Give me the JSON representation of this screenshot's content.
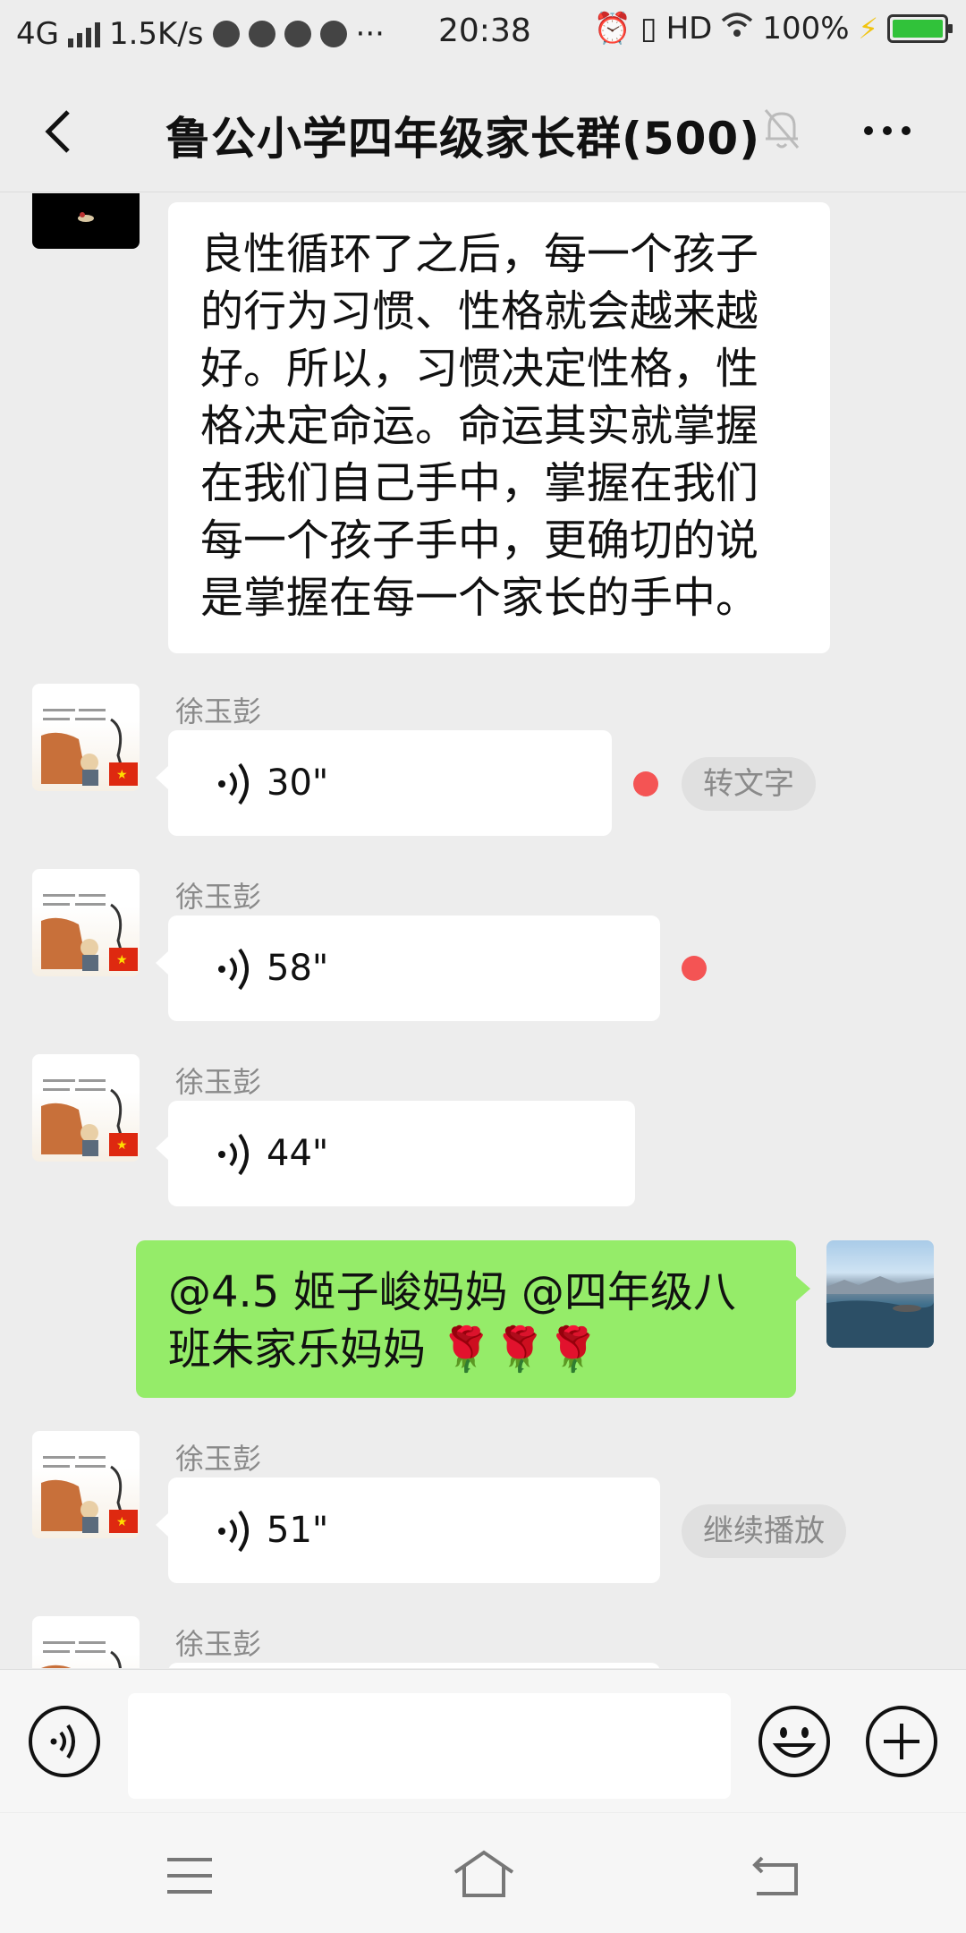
{
  "status_bar": {
    "network": "4G",
    "speed": "1.5K/s",
    "time": "20:38",
    "hd": "HD",
    "battery": "100%"
  },
  "header": {
    "title": "鲁公小学四年级家长群(500)"
  },
  "messages": [
    {
      "type": "text",
      "lines": [
        "良性循环了之后，每一个孩子",
        "的行为习惯、性格就会越来越",
        "好。所以，习惯决定性格，性",
        "格决定命运。命运其实就掌握",
        "在我们自己手中，掌握在我们",
        "每一个孩子手中，更确切的说",
        "是掌握在每一个家长的手中。"
      ]
    },
    {
      "type": "voice",
      "sender": "徐玉彭",
      "duration": "30\"",
      "action": "转文字"
    },
    {
      "type": "voice",
      "sender": "徐玉彭",
      "duration": "58\""
    },
    {
      "type": "voice",
      "sender": "徐玉彭",
      "duration": "44\""
    },
    {
      "type": "text_self",
      "lines": [
        "@4.5 姬子峻妈妈  @四年级八",
        "班朱家乐妈妈  🌹🌹🌹"
      ]
    },
    {
      "type": "voice",
      "sender": "徐玉彭",
      "duration": "51\"",
      "action": "继续播放"
    },
    {
      "type": "voice",
      "sender": "徐玉彭"
    }
  ],
  "input": {
    "value": "",
    "placeholder": ""
  },
  "colors": {
    "self_bubble": "#95ec69",
    "unread": "#f45454",
    "battery": "#31c23a"
  }
}
